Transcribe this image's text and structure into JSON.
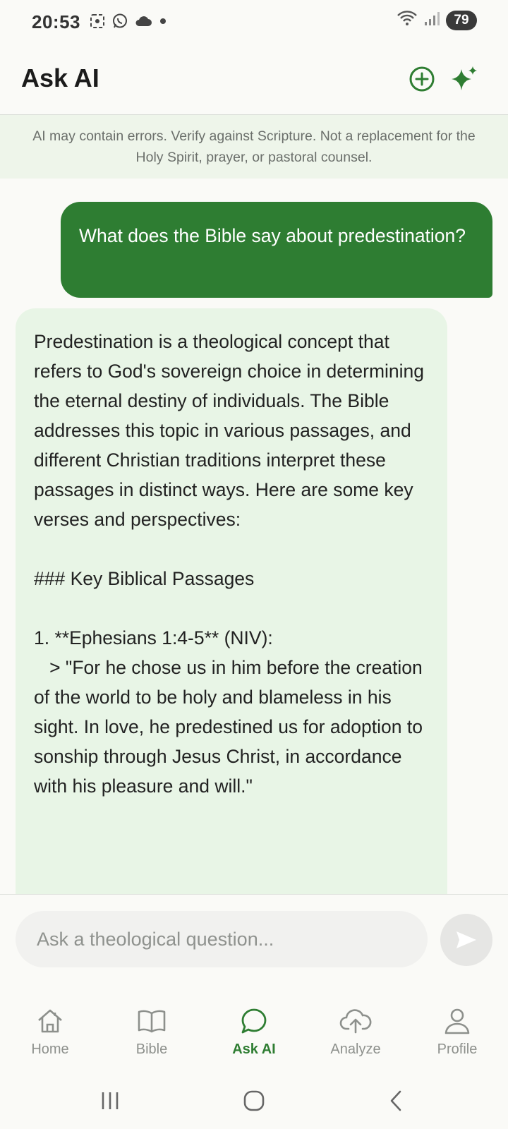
{
  "status_bar": {
    "time": "20:53",
    "battery": "79"
  },
  "header": {
    "title": "Ask AI"
  },
  "disclaimer": {
    "text": "AI may contain errors. Verify against Scripture. Not a replacement for the Holy Spirit, prayer, or pastoral counsel."
  },
  "chat": {
    "messages": [
      {
        "role": "user",
        "text": "What does the Bible say about predestination?"
      },
      {
        "role": "assistant",
        "text": "Predestination is a theological concept that refers to God's sovereign choice in determining the eternal destiny of individuals. The Bible addresses this topic in various passages, and different Christian traditions interpret these passages in distinct ways. Here are some key verses and perspectives:\n\n### Key Biblical Passages\n\n1. **Ephesians 1:4-5** (NIV):\n   > \"For he chose us in him before the creation of the world to be holy and blameless in his sight. In love, he predestined us for adoption to sonship through Jesus Christ, in accordance with his pleasure and will.\""
      }
    ]
  },
  "input": {
    "placeholder": "Ask a theological question..."
  },
  "nav": {
    "items": [
      {
        "label": "Home",
        "icon": "home-icon"
      },
      {
        "label": "Bible",
        "icon": "book-icon"
      },
      {
        "label": "Ask AI",
        "icon": "chat-icon",
        "active": true
      },
      {
        "label": "Analyze",
        "icon": "cloud-upload-icon"
      },
      {
        "label": "Profile",
        "icon": "person-icon"
      }
    ]
  },
  "colors": {
    "accent": "#2e7d32",
    "ai_bubble": "#e8f5e6",
    "disclaimer_bg": "#eef5ea",
    "nav_inactive": "#8d908c"
  }
}
